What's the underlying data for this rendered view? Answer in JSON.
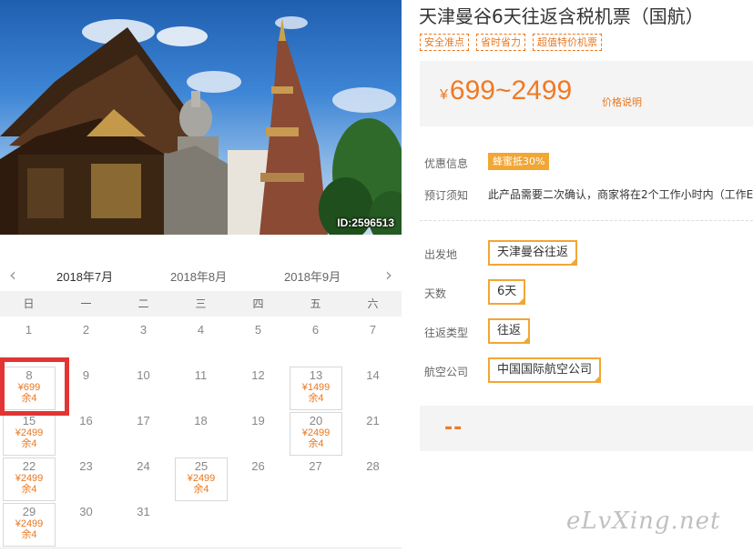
{
  "hero": {
    "image_id": "ID:2596513"
  },
  "product": {
    "title": "天津曼谷6天往返含税机票（国航）",
    "tags": [
      "安全准点",
      "省时省力",
      "超值特价机票"
    ],
    "price": {
      "currency": "¥",
      "range": "699~2499",
      "note": "价格说明"
    },
    "promo": {
      "label": "优惠信息",
      "badge": "蜂蜜抵30%"
    },
    "booking_notice": {
      "label": "预订须知",
      "text": "此产品需要二次确认，商家将在2个工作小时内（工作E"
    },
    "options": [
      {
        "label": "出发地",
        "value": "天津曼谷往返"
      },
      {
        "label": "天数",
        "value": "6天"
      },
      {
        "label": "往返类型",
        "value": "往返"
      },
      {
        "label": "航空公司",
        "value": "中国国际航空公司"
      }
    ],
    "total_placeholder": "--"
  },
  "calendar": {
    "prev_icon": "chevron-left-icon",
    "next_icon": "chevron-right-icon",
    "months": [
      "2018年7月",
      "2018年8月",
      "2018年9月"
    ],
    "active_month": 0,
    "weekdays": [
      "日",
      "一",
      "二",
      "三",
      "四",
      "五",
      "六"
    ],
    "days": [
      {
        "d": "1"
      },
      {
        "d": "2"
      },
      {
        "d": "3"
      },
      {
        "d": "4"
      },
      {
        "d": "5"
      },
      {
        "d": "6"
      },
      {
        "d": "7"
      },
      {
        "d": "8",
        "price": "¥699",
        "left": "余4"
      },
      {
        "d": "9"
      },
      {
        "d": "10"
      },
      {
        "d": "11"
      },
      {
        "d": "12"
      },
      {
        "d": "13",
        "price": "¥1499",
        "left": "余4"
      },
      {
        "d": "14"
      },
      {
        "d": "15",
        "price": "¥2499",
        "left": "余4"
      },
      {
        "d": "16"
      },
      {
        "d": "17"
      },
      {
        "d": "18"
      },
      {
        "d": "19"
      },
      {
        "d": "20",
        "price": "¥2499",
        "left": "余4"
      },
      {
        "d": "21"
      },
      {
        "d": "22",
        "price": "¥2499",
        "left": "余4"
      },
      {
        "d": "23"
      },
      {
        "d": "24"
      },
      {
        "d": "25",
        "price": "¥2499",
        "left": "余4"
      },
      {
        "d": "26"
      },
      {
        "d": "27"
      },
      {
        "d": "28"
      },
      {
        "d": "29",
        "price": "¥2499",
        "left": "余4"
      },
      {
        "d": "30"
      },
      {
        "d": "31"
      }
    ]
  },
  "watermark": "eLvXing.net",
  "colors": {
    "accent": "#f07a24",
    "tag_border": "#e8771f",
    "option_border": "#f2a634",
    "highlight": "#e23434"
  }
}
